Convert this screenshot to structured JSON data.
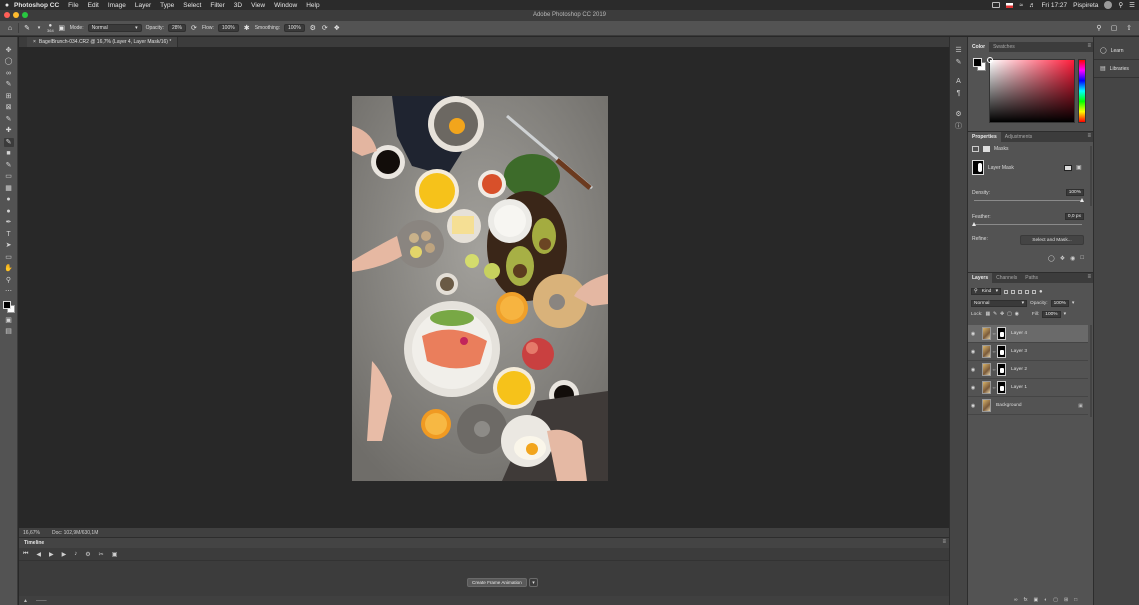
{
  "menubar": {
    "app_name": "Photoshop CC",
    "items": [
      "File",
      "Edit",
      "Image",
      "Layer",
      "Type",
      "Select",
      "Filter",
      "3D",
      "View",
      "Window",
      "Help"
    ],
    "clock": "Fri 17:27",
    "user": "Pispireta"
  },
  "titlebar": {
    "title": "Adobe Photoshop CC 2019"
  },
  "options": {
    "brush_size": "364",
    "mode_label": "Mode:",
    "mode_value": "Normal",
    "opacity_label": "Opacity:",
    "opacity_value": "28%",
    "flow_label": "Flow:",
    "flow_value": "100%",
    "smoothing_label": "Smoothing:",
    "smoothing_value": "100%"
  },
  "document": {
    "tab_title": "BagelBrunch-034.CR2 @ 16,7% (Layer 4, Layer Mask/16) *",
    "zoom": "16,67%",
    "doc_info": "Doc: 102,9M/630,1M"
  },
  "timeline": {
    "title": "Timeline",
    "create_button": "Create Frame Animation"
  },
  "color_panel": {
    "tabs": [
      "Color",
      "Swatches"
    ],
    "fg": "#000000",
    "bg": "#ffffff",
    "accent": "#ff1e3c"
  },
  "properties_panel": {
    "tabs": [
      "Properties",
      "Adjustments"
    ],
    "section": "Masks",
    "mask_name": "Layer Mask",
    "density_label": "Density:",
    "density_value": "100%",
    "density_percent": 100,
    "feather_label": "Feather:",
    "feather_value": "0,0 px",
    "feather_percent": 0,
    "refine_label": "Refine:",
    "select_mask_button": "Select and Mask..."
  },
  "layers_panel": {
    "tabs": [
      "Layers",
      "Channels",
      "Paths"
    ],
    "kind_label": "Kind",
    "blend_mode": "Normal",
    "opacity_label": "Opacity:",
    "opacity_value": "100%",
    "lock_label": "Lock:",
    "fill_label": "Fill:",
    "fill_value": "100%",
    "layers": [
      {
        "name": "Layer 4",
        "selected": true,
        "has_mask": true
      },
      {
        "name": "Layer 3",
        "selected": false,
        "has_mask": true
      },
      {
        "name": "Layer 2",
        "selected": false,
        "has_mask": true
      },
      {
        "name": "Layer 1",
        "selected": false,
        "has_mask": true
      },
      {
        "name": "Background",
        "selected": false,
        "has_mask": false
      }
    ]
  },
  "side_panels": {
    "learn": "Learn",
    "libraries": "Libraries"
  }
}
